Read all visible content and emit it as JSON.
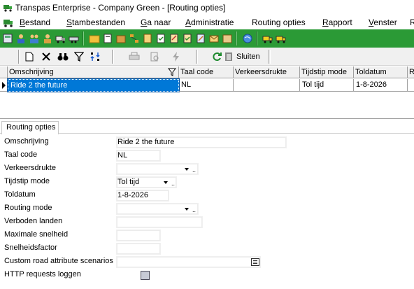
{
  "window": {
    "title": "Transpas Enterprise - Company Green - [Routing opties]"
  },
  "menu": {
    "items": [
      {
        "underline": "B",
        "rest": "estand"
      },
      {
        "underline": "S",
        "rest": "tambestanden"
      },
      {
        "underline": "G",
        "rest": "a naar"
      },
      {
        "underline": "A",
        "rest": "dministratie"
      },
      {
        "underline": "",
        "rest": "Routing opties"
      },
      {
        "underline": "R",
        "rest": "apport"
      },
      {
        "underline": "V",
        "rest": "enster"
      },
      {
        "underline": "",
        "rest": "R"
      }
    ]
  },
  "toolbar": {
    "new_icon": "new-document-icon",
    "delete_icon": "delete-icon",
    "find_icon": "binoculars-icon",
    "filter_icon": "filter-icon",
    "sort_icon": "sort-icon",
    "print_icon": "print-icon",
    "preview_icon": "print-preview-icon",
    "flash_icon": "lightning-icon",
    "refresh_icon": "refresh-icon",
    "close_label": "Sluiten"
  },
  "grid": {
    "columns": [
      "Omschrijving",
      "Taal code",
      "Verkeersdrukte",
      "Tijdstip mode",
      "Toldatum",
      "R"
    ],
    "rows": [
      [
        "Ride 2 the future",
        "NL",
        "",
        "Tol tijd",
        "1-8-2026",
        ""
      ]
    ]
  },
  "tab": {
    "label": "Routing opties"
  },
  "form": {
    "omschrijving": {
      "label": "Omschrijving",
      "value": "Ride 2 the future"
    },
    "taal_code": {
      "label": "Taal code",
      "value": "NL"
    },
    "verkeersdrukte": {
      "label": "Verkeersdrukte",
      "value": ""
    },
    "tijdstip_mode": {
      "label": "Tijdstip mode",
      "value": "Tol tijd"
    },
    "toldatum": {
      "label": "Toldatum",
      "value": "1-8-2026"
    },
    "routing_mode": {
      "label": "Routing mode",
      "value": ""
    },
    "verboden_landen": {
      "label": "Verboden landen",
      "value": ""
    },
    "maximale_snelheid": {
      "label": "Maximale snelheid",
      "value": ""
    },
    "snelheidsfactor": {
      "label": "Snelheidsfactor",
      "value": ""
    },
    "custom_road": {
      "label": "Custom road attribute scenarios",
      "value": ""
    },
    "http_log": {
      "label": "HTTP requests loggen",
      "checked": false
    }
  },
  "colors": {
    "green_toolbar": "#2b9a36",
    "selection": "#0078d7"
  }
}
